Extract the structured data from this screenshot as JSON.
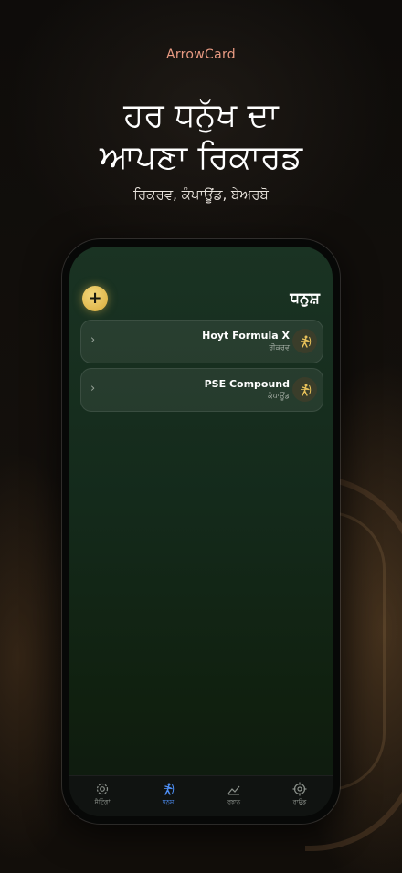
{
  "brand": "ArrowCard",
  "headline": {
    "line1": "ਹਰ ਧਨੁੱਖ ਦਾ",
    "line2": "ਆਪਣਾ ਰਿਕਾਰਡ"
  },
  "subline": "ਰਿਕਰਵ, ਕੰਪਾਊਂਡ, ਬੇਅਰਬੋ",
  "app": {
    "title": "ਧਨੁਸ਼",
    "add_label": "+",
    "bows": [
      {
        "name": "Hoyt Formula X",
        "type": "ਰੀਕਰਵ",
        "icon": "archer-icon"
      },
      {
        "name": "PSE Compound",
        "type": "ਕੰਪਾਊਂਡ",
        "icon": "archer-icon"
      }
    ],
    "tabs": [
      {
        "label": "ਸੈਟਿੰਗਾਂ",
        "icon": "gear-icon"
      },
      {
        "label": "ਧਨੁਸ਼",
        "icon": "archer-icon",
        "active": true
      },
      {
        "label": "ਰੁਝਾਨ",
        "icon": "chart-icon"
      },
      {
        "label": "ਰਾਊਂਡ",
        "icon": "target-icon"
      }
    ]
  },
  "colors": {
    "accent_gold": "#e7c15a",
    "active_tab": "#4e8ff5",
    "brand_text": "#e89a82",
    "screen_green": "#1a3323"
  }
}
